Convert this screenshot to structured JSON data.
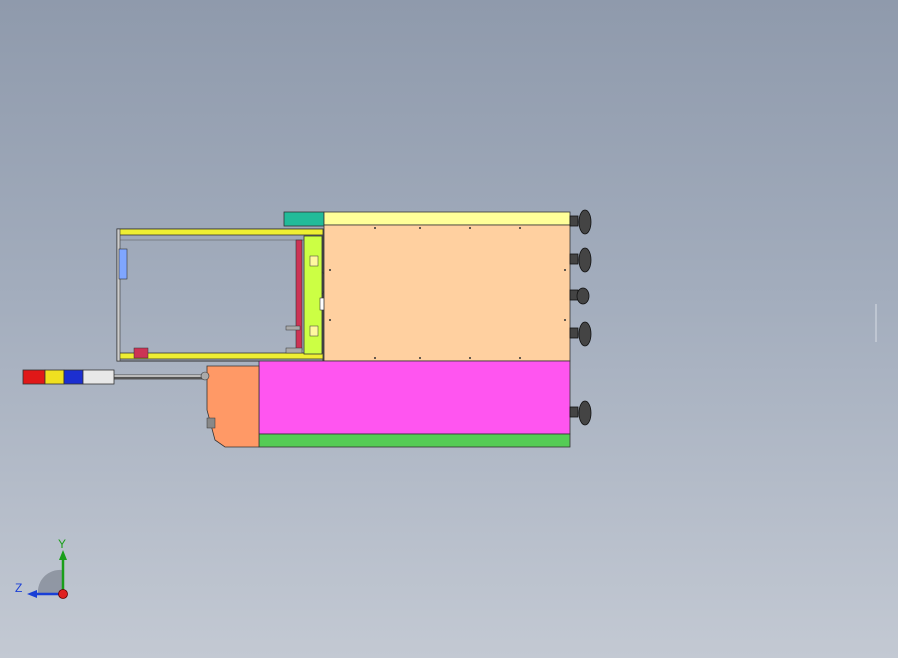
{
  "viewport": {
    "background_top": "#8f9aac",
    "background_bottom": "#c3c9d3"
  },
  "triad": {
    "y_label": "Y",
    "z_label": "Z",
    "y_color": "#1a9e1a",
    "z_color": "#1a3fd6",
    "x_color": "#e02020"
  },
  "colors": {
    "cabinet_upper": "#ffd0a0",
    "cabinet_lower": "#ff55f0",
    "top_rail": "#ffff99",
    "bottom_rail": "#55cc55",
    "end_cap": "#ff9966",
    "teal_block": "#22bb99",
    "frame_yellow": "#eeee33",
    "side_green": "#ccff44",
    "lamp_red": "#e01818",
    "lamp_yellow": "#f0e020",
    "lamp_blue": "#1c2fd0",
    "lamp_white": "#e8e8e8"
  }
}
